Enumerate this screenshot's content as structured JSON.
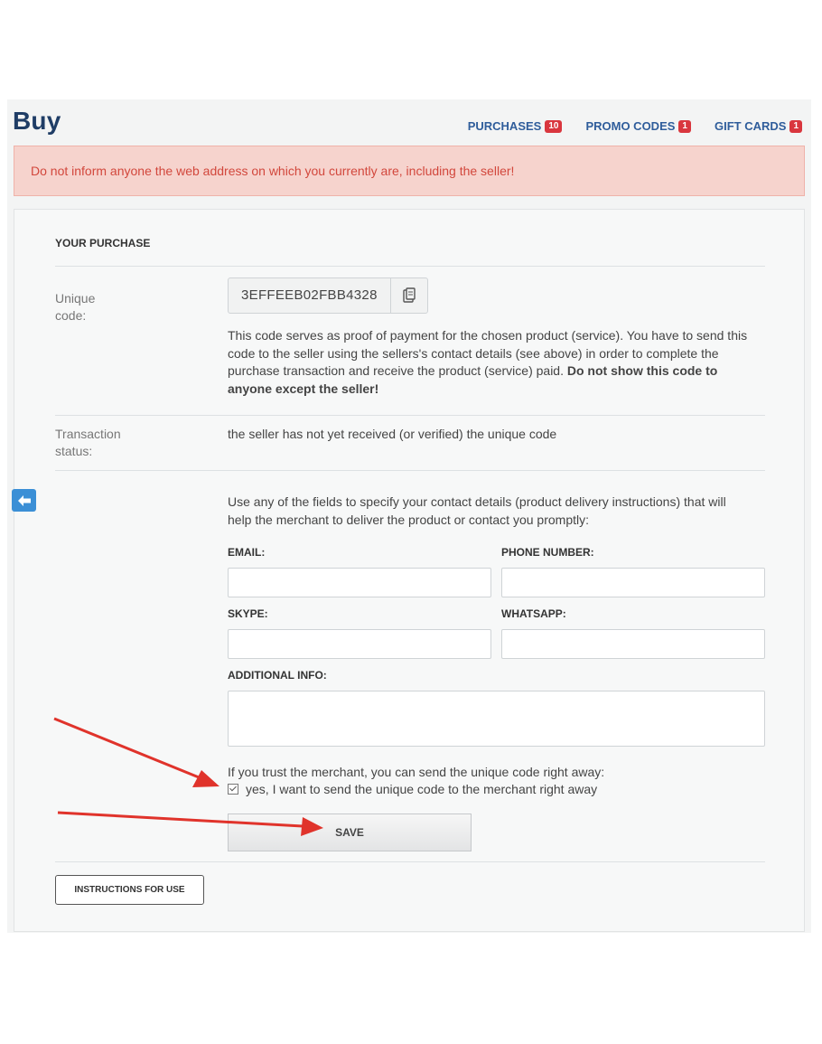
{
  "header": {
    "title": "Buy",
    "nav": [
      {
        "label": "PURCHASES",
        "count": "10"
      },
      {
        "label": "PROMO CODES",
        "count": "1"
      },
      {
        "label": "GIFT CARDS",
        "count": "1"
      }
    ]
  },
  "alert": {
    "text": "Do not inform anyone the web address on which you currently are, including the seller!"
  },
  "purchase": {
    "section_title": "YOUR PURCHASE",
    "unique_code_label": "Unique code:",
    "unique_code_value": "3EFFEEB02FBB4328",
    "code_note_plain": "This code serves as proof of payment for the chosen product (service). You have to send this code to the seller using the sellers's contact details (see above) in order to complete the purchase transaction and receive the product (service) paid.",
    "code_note_bold": "Do not show this code to anyone except the seller!",
    "status_label": "Transaction status:",
    "status_value": "the seller has not yet received (or verified) the unique code"
  },
  "contact": {
    "intro": "Use any of the fields to specify your contact details (product delivery instructions) that will help the merchant to deliver the product or contact you promptly:",
    "email_label": "EMAIL:",
    "phone_label": "PHONE NUMBER:",
    "skype_label": "SKYPE:",
    "whatsapp_label": "WHATSAPP:",
    "additional_label": "ADDITIONAL INFO:",
    "email_value": "",
    "phone_value": "",
    "skype_value": "",
    "whatsapp_value": "",
    "additional_value": ""
  },
  "send_code": {
    "prompt": "If you trust the merchant, you can send the unique code right away:",
    "checkbox_label": "yes, I want to send the unique code to the merchant right away",
    "checked": true
  },
  "buttons": {
    "save": "SAVE",
    "instructions": "INSTRUCTIONS FOR USE"
  },
  "colors": {
    "title": "#1f3d66",
    "nav_link": "#2f5d9b",
    "badge": "#d9363e",
    "alert_bg": "#f6d3cd",
    "alert_text": "#d2473c",
    "annotation_arrow": "#e0332b",
    "side_button": "#3b8fd6"
  },
  "icons": {
    "copy": "clipboard-icon",
    "side": "arrow-left-icon"
  }
}
